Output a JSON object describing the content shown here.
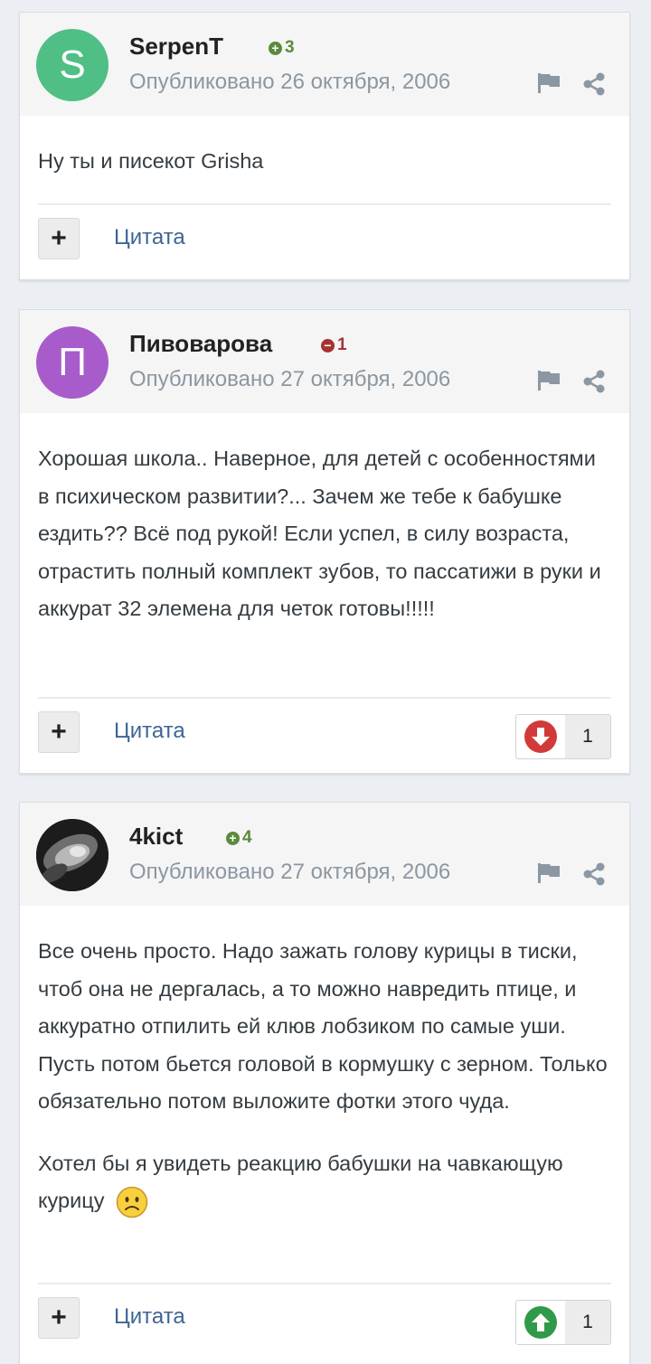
{
  "posts": [
    {
      "avatar_letter": "S",
      "avatar_color": "#4fbf86",
      "author": "SerpenT",
      "reputation": "3",
      "reputation_type": "positive",
      "date": "Опубликовано 26 октября, 2006",
      "paragraphs": [
        "Ну ты и писекот Grisha"
      ],
      "quote_label": "Цитата"
    },
    {
      "avatar_letter": "П",
      "avatar_color": "#a85ccb",
      "author": "Пивоварова",
      "reputation": "1",
      "reputation_type": "negative",
      "date": "Опубликовано 27 октября, 2006",
      "paragraphs": [
        "Хорошая школа.. Наверное, для детей с особенностями в психическом развитии?... Зачем же тебе к бабушке ездить?? Всё под рукой! Если успел, в силу возраста, отрастить полный комплект зубов, то пассатижи в руки и аккурат 32 элемена для четок готовы!!!!!"
      ],
      "quote_label": "Цитата",
      "vote_count": "1",
      "vote_type": "down"
    },
    {
      "avatar_letter": "",
      "avatar_color": "#2a2a2a",
      "author": "4kict",
      "reputation": "4",
      "reputation_type": "positive",
      "date": "Опубликовано 27 октября, 2006",
      "paragraphs": [
        "Все очень просто. Надо зажать голову курицы в тиски, чтоб она не дергалась, а то можно навредить птице, и аккуратно отпилить ей клюв лобзиком по самые уши. Пусть потом бьется головой в кормушку с зерном. Только обязательно потом выложите фотки этого чуда.",
        "Хотел бы я увидеть реакцию бабушки на чавкающую курицу"
      ],
      "quote_label": "Цитата",
      "vote_count": "1",
      "vote_type": "up"
    }
  ],
  "colors": {
    "positive": "#5a8a3b",
    "negative": "#a83232",
    "link": "#3d6594",
    "vote_down": "#d23a3a",
    "vote_up": "#2f9a4a"
  },
  "icons": [
    "flag-icon",
    "share-icon",
    "plus-icon",
    "vote-down-icon",
    "vote-up-icon",
    "sad-emoji-icon"
  ]
}
